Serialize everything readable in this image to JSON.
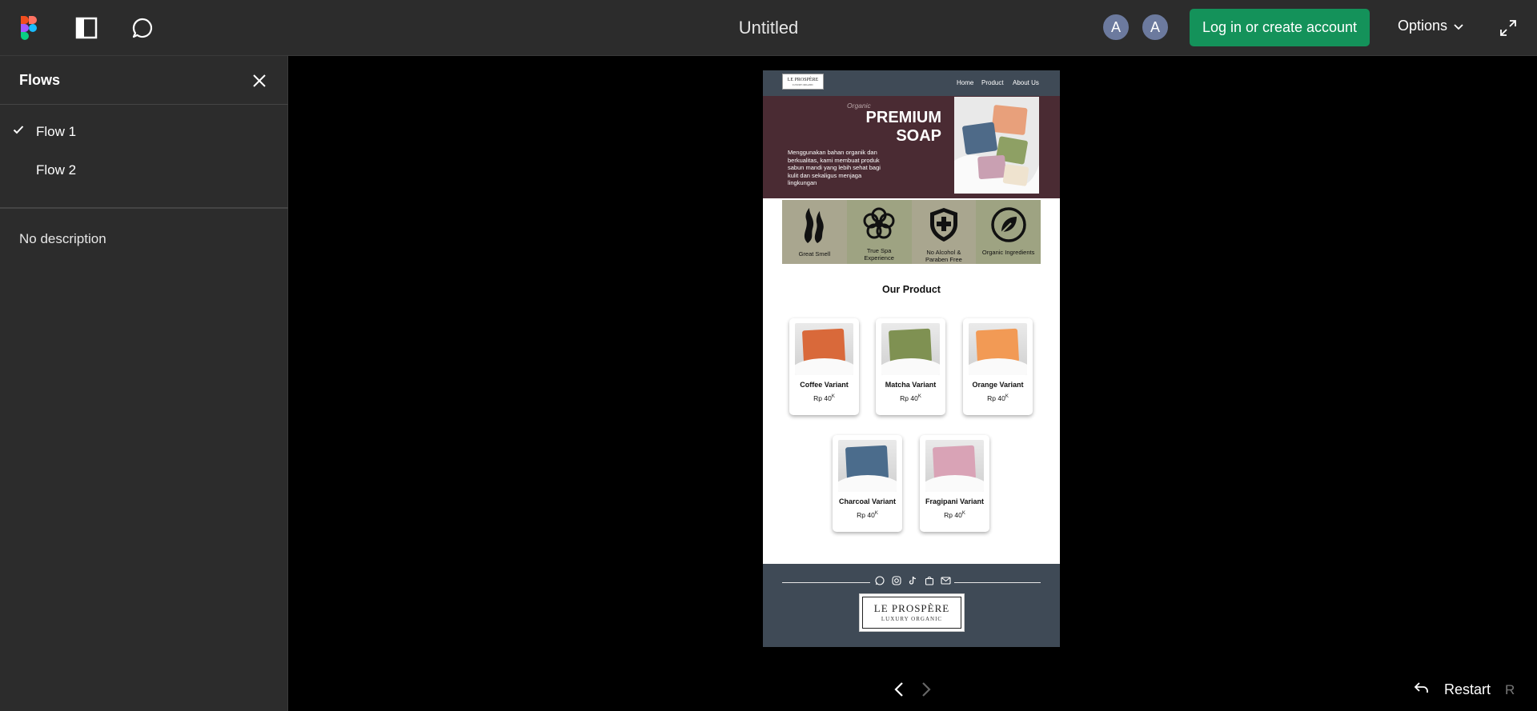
{
  "topbar": {
    "title": "Untitled",
    "avatars": [
      "A",
      "A"
    ],
    "login_label": "Log in or create account",
    "options_label": "Options",
    "icons": [
      "figma-logo-icon",
      "sidebar-toggle-icon",
      "comment-icon",
      "expand-icon",
      "chevron-down-icon"
    ]
  },
  "sidebar": {
    "title": "Flows",
    "flows": [
      {
        "label": "Flow 1",
        "selected": true
      },
      {
        "label": "Flow 2",
        "selected": false
      }
    ],
    "description": "No description"
  },
  "prototype": {
    "nav": {
      "logo_line1": "LE PROSPÈRE",
      "logo_line2": "LUXURY ORGANIC",
      "links": [
        "Home",
        "Product",
        "About Us"
      ]
    },
    "hero": {
      "eyebrow": "Organic",
      "title_line1": "PREMIUM",
      "title_line2": "SOAP",
      "description": "Menggunakan bahan organik dan berkualitas, kami membuat produk sabun mandi yang lebih sehat bagi kulit dan sekaligus menjaga lingkungan"
    },
    "features": [
      {
        "label": "Great Smell",
        "icon": "flame-icon",
        "bg": "#a9a68f"
      },
      {
        "label": "True Spa Experience",
        "icon": "flower-icon",
        "bg": "#9ea382"
      },
      {
        "label": "No Alcohol & Paraben Free",
        "icon": "shield-plus-icon",
        "bg": "#a9a68f"
      },
      {
        "label": "Organic Ingredients",
        "icon": "leaf-icon",
        "bg": "#9ea382"
      }
    ],
    "products_title": "Our Product",
    "products": [
      {
        "name": "Coffee Variant",
        "price": "Rp 40",
        "price_suffix": "K",
        "soap_color": "#d9693a"
      },
      {
        "name": "Matcha Variant",
        "price": "Rp 40",
        "price_suffix": "K",
        "soap_color": "#7f9152"
      },
      {
        "name": "Orange Variant",
        "price": "Rp 40",
        "price_suffix": "K",
        "soap_color": "#f29a55"
      },
      {
        "name": "Charcoal Variant",
        "price": "Rp 40",
        "price_suffix": "K",
        "soap_color": "#4b6c8c"
      },
      {
        "name": "Fragipani Variant",
        "price": "Rp 40",
        "price_suffix": "K",
        "soap_color": "#d9a3b6"
      }
    ],
    "footer": {
      "social_icons": [
        "whatsapp-icon",
        "instagram-icon",
        "tiktok-icon",
        "shop-icon",
        "mail-icon"
      ],
      "logo_line1": "LE PROSPÈRE",
      "logo_line2": "LUXURY ORGANIC"
    }
  },
  "controls": {
    "restart_label": "Restart",
    "restart_shortcut": "R"
  },
  "colors": {
    "topbar_bg": "#2c2c2c",
    "login_green": "#14925a",
    "avatar": "#6c7a9e",
    "nav_slate": "#3f4a56",
    "hero_maroon": "#4a2b33"
  }
}
